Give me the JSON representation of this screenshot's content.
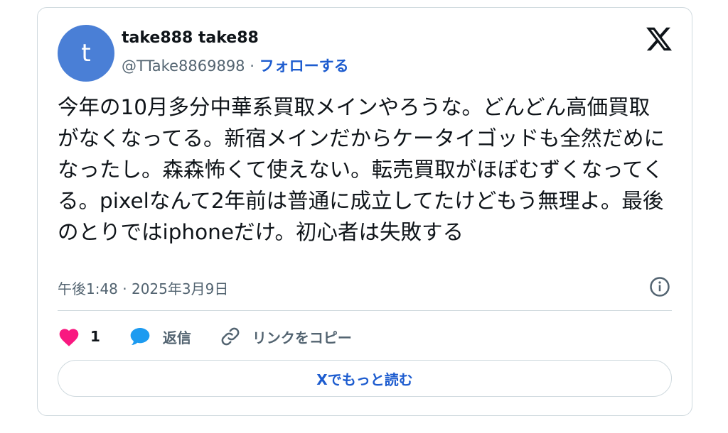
{
  "author": {
    "avatar_letter": "t",
    "display_name": "take888 take88",
    "handle": "@TTake8869898",
    "separator": " · ",
    "follow_label": "フォローする"
  },
  "tweet": {
    "text": "今年の10月多分中華系買取メインやろうな。どんどん高価買取がなくなってる。新宿メインだからケータイゴッドも全然だめになったし。森森怖くて使えない。転売買取がほぼむずくなってくる。pixelなんて2年前は普通に成立してたけどもう無理よ。最後のとりではiphoneだけ。初心者は失敗する",
    "timestamp": "午後1:48 · 2025年3月9日"
  },
  "actions": {
    "like_count": "1",
    "reply_label": "返信",
    "copy_link_label": "リンクをコピー"
  },
  "read_more_label": "Xでもっと読む",
  "colors": {
    "avatar": "#4a7fd6",
    "link": "#1d5ccf",
    "heart": "#f91880",
    "reply_bubble": "#1d9bf0",
    "muted_text": "#536471",
    "border": "#cfd9de"
  },
  "icons": [
    "x-logo-icon",
    "info-icon",
    "heart-icon",
    "reply-bubble-icon",
    "link-icon"
  ]
}
